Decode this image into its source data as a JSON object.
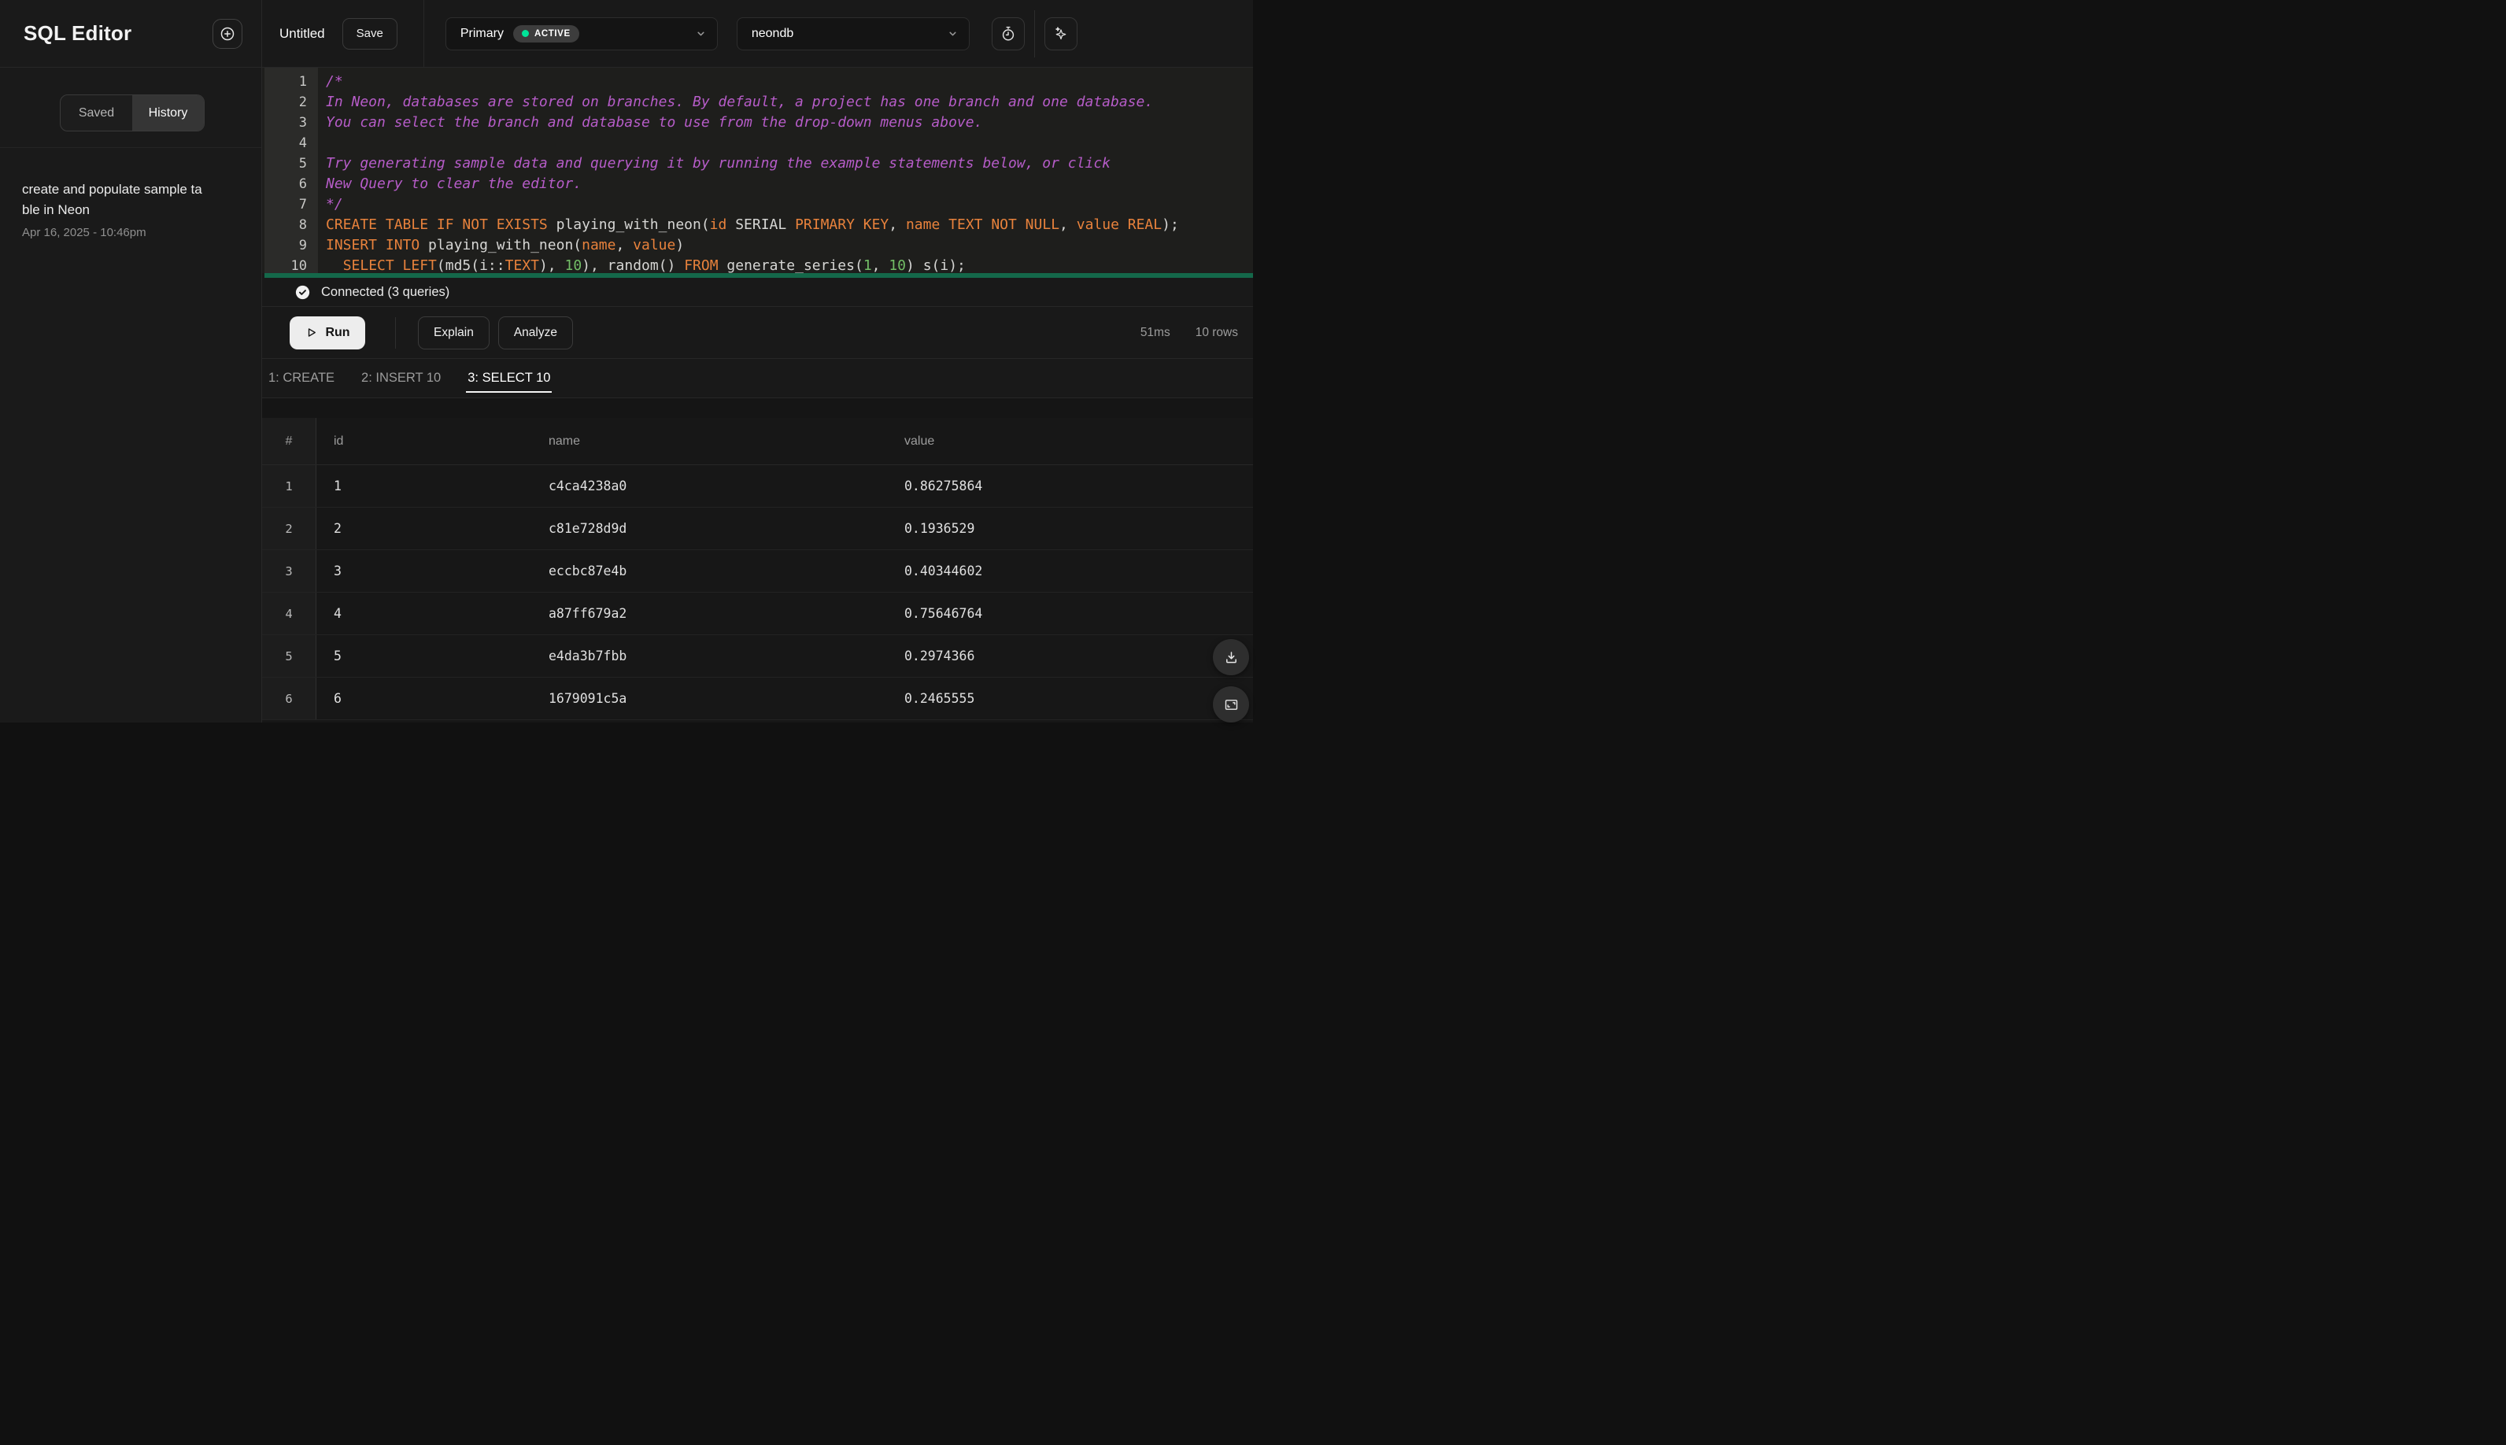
{
  "sidebar": {
    "title": "SQL Editor",
    "tabs": [
      {
        "label": "Saved",
        "active": false
      },
      {
        "label": "History",
        "active": true
      }
    ],
    "history": [
      {
        "title": "create and populate sample table in Neon",
        "date": "Apr 16, 2025 - 10:46pm"
      }
    ]
  },
  "topbar": {
    "editor_name": "Untitled",
    "save_label": "Save",
    "branch": {
      "name": "Primary",
      "status_badge": "ACTIVE",
      "status_color": "#00e599"
    },
    "database": {
      "name": "neondb"
    }
  },
  "editor": {
    "lines": [
      {
        "n": 1,
        "s": [
          [
            "c",
            "/*"
          ]
        ]
      },
      {
        "n": 2,
        "s": [
          [
            "c",
            "In Neon, databases are stored on branches. By default, a project has one branch and one database."
          ]
        ]
      },
      {
        "n": 3,
        "s": [
          [
            "c",
            "You can select the branch and database to use from the drop-down menus above."
          ]
        ]
      },
      {
        "n": 4,
        "s": []
      },
      {
        "n": 5,
        "s": [
          [
            "c",
            "Try generating sample data and querying it by running the example statements below, or click"
          ]
        ]
      },
      {
        "n": 6,
        "s": [
          [
            "c",
            "New Query to clear the editor."
          ]
        ]
      },
      {
        "n": 7,
        "s": [
          [
            "c",
            "*/"
          ]
        ]
      },
      {
        "n": 8,
        "s": [
          [
            "k",
            "CREATE TABLE IF NOT EXISTS"
          ],
          [
            "p",
            " playing_with_neon("
          ],
          [
            "k",
            "id"
          ],
          [
            "p",
            " SERIAL "
          ],
          [
            "k",
            "PRIMARY KEY"
          ],
          [
            "p",
            ", "
          ],
          [
            "k",
            "name TEXT NOT NULL"
          ],
          [
            "p",
            ", "
          ],
          [
            "k",
            "value REAL"
          ],
          [
            "p",
            ");"
          ]
        ]
      },
      {
        "n": 9,
        "s": [
          [
            "k",
            "INSERT INTO"
          ],
          [
            "p",
            " playing_with_neon("
          ],
          [
            "k",
            "name"
          ],
          [
            "p",
            ", "
          ],
          [
            "k",
            "value"
          ],
          [
            "p",
            ")"
          ]
        ]
      },
      {
        "n": 10,
        "s": [
          [
            "p",
            "  "
          ],
          [
            "k",
            "SELECT LEFT"
          ],
          [
            "p",
            "(md5(i::"
          ],
          [
            "k",
            "TEXT"
          ],
          [
            "p",
            "), "
          ],
          [
            "n",
            "10"
          ],
          [
            "p",
            "), random() "
          ],
          [
            "k",
            "FROM"
          ],
          [
            "p",
            " generate_series("
          ],
          [
            "n",
            "1"
          ],
          [
            "p",
            ", "
          ],
          [
            "n",
            "10"
          ],
          [
            "p",
            ") s(i);"
          ]
        ]
      }
    ]
  },
  "status_bar": {
    "text": "Connected (3 queries)"
  },
  "actions": {
    "run": "Run",
    "explain": "Explain",
    "analyze": "Analyze",
    "duration": "51ms",
    "row_count": "10 rows"
  },
  "result_tabs": [
    {
      "label": "1: CREATE",
      "active": false
    },
    {
      "label": "2: INSERT 10",
      "active": false
    },
    {
      "label": "3: SELECT 10",
      "active": true
    }
  ],
  "results_table": {
    "columns": [
      "#",
      "id",
      "name",
      "value"
    ],
    "rows": [
      {
        "num": "1",
        "id": "1",
        "name": "c4ca4238a0",
        "value": "0.86275864"
      },
      {
        "num": "2",
        "id": "2",
        "name": "c81e728d9d",
        "value": "0.1936529"
      },
      {
        "num": "3",
        "id": "3",
        "name": "eccbc87e4b",
        "value": "0.40344602"
      },
      {
        "num": "4",
        "id": "4",
        "name": "a87ff679a2",
        "value": "0.75646764"
      },
      {
        "num": "5",
        "id": "5",
        "name": "e4da3b7fbb",
        "value": "0.2974366"
      },
      {
        "num": "6",
        "id": "6",
        "name": "1679091c5a",
        "value": "0.2465555"
      }
    ]
  },
  "colors": {
    "accent_green": "#00e599",
    "editor_divider_green": "#14684a",
    "syntax_keyword": "#e8823c",
    "syntax_comment": "#b65cc8",
    "syntax_number": "#72bd66"
  }
}
